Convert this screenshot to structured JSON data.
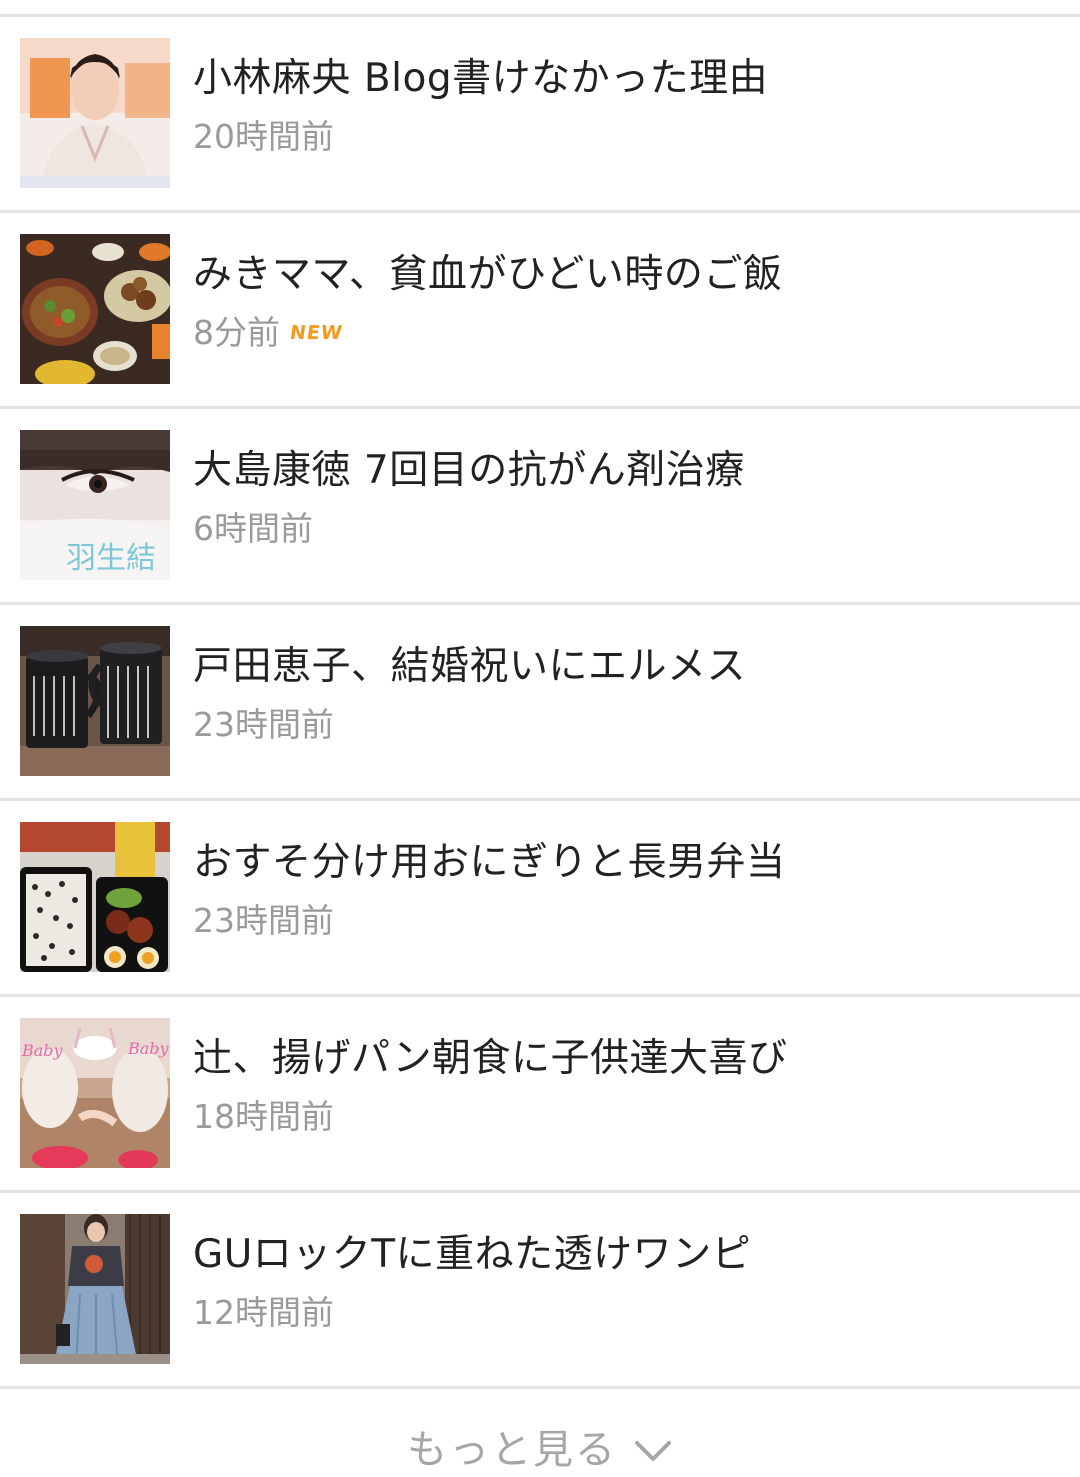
{
  "articles": [
    {
      "title": "小林麻央 Blog書けなかった理由",
      "time": "20時間前",
      "badge": "",
      "thumb": "woman-kimono-photo"
    },
    {
      "title": "みきママ、貧血がひどい時のご飯",
      "time": "8分前",
      "badge": "NEW",
      "thumb": "dinner-table-photo"
    },
    {
      "title": "大島康徳 7回目の抗がん剤治療",
      "time": "6時間前",
      "badge": "",
      "thumb": "face-closeup-photo"
    },
    {
      "title": "戸田恵子、結婚祝いにエルメス",
      "time": "23時間前",
      "badge": "",
      "thumb": "mugs-photo"
    },
    {
      "title": "おすそ分け用おにぎりと長男弁当",
      "time": "23時間前",
      "badge": "",
      "thumb": "bento-photo"
    },
    {
      "title": "辻、揚げパン朝食に子供達大喜び",
      "time": "18時間前",
      "badge": "",
      "thumb": "kids-breakfast-photo"
    },
    {
      "title": "GUロックTに重ねた透けワンピ",
      "time": "12時間前",
      "badge": "",
      "thumb": "outfit-photo"
    }
  ],
  "thumb_overlay_text": "羽生結",
  "more": {
    "label": "もっと見る",
    "icon": "chevron-down-icon"
  },
  "colors": {
    "title": "#222222",
    "time": "#9a9a9a",
    "new_badge": "#f39a1e",
    "divider": "#e3e3e3"
  }
}
